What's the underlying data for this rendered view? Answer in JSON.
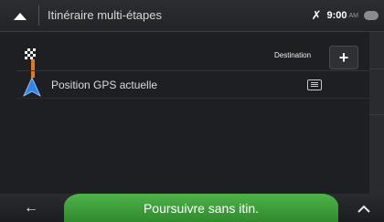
{
  "header": {
    "title": "Itinéraire multi-étapes",
    "status": {
      "time": "9:00",
      "ampm": "AM",
      "signal_icon": "satellite-off-icon",
      "message_icon": "message-bubble-icon"
    }
  },
  "route": {
    "destination_label": "Destination",
    "add_icon": "plus-icon",
    "waypoints": [
      {
        "label": "Position GPS actuelle",
        "icon": "gps-arrow-icon",
        "menu_icon": "list-menu-icon"
      }
    ],
    "flag_icon": "checkered-flag-icon"
  },
  "footer": {
    "continue_label": "Poursuivre sans itin.",
    "back_icon": "back-arrow-icon",
    "more_icon": "chevron-up-icon"
  },
  "colors": {
    "accent_green": "#3fa13a",
    "route_orange": "#e07a1a",
    "gps_blue": "#2f86e6"
  }
}
